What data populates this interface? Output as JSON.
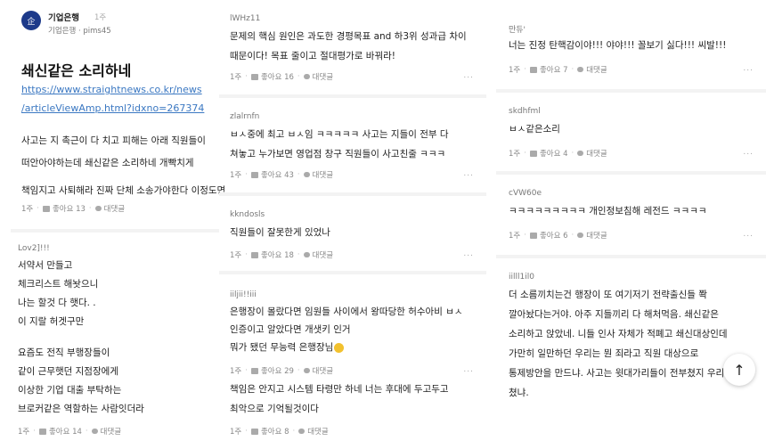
{
  "article": {
    "logo_text": "企",
    "author": "기업은행",
    "time": "1주",
    "sub_company": "기업은행",
    "sub_user": "pims45",
    "title": "쇄신같은 소리하네",
    "link_line1": "https://www.straightnews.co.kr/news",
    "link_line2": "/articleViewAmp.html?idxno=267374",
    "body_line1": "사고는 지 촉근이 다 치고 피해는 아래 직원들이",
    "body_line2": "떠안아야하는데 쇄신같은 소리하네 개빡치게",
    "body_line3": "책임지고 사퇴해라 진짜 단체 소송가야한다 이정도면",
    "time_meta": "1주",
    "likes": "좋아요 13",
    "reply": "대댓글"
  },
  "comments": [
    {
      "nick": "Lov2]!!!",
      "lines": [
        "서약서 만들고",
        "체크리스트 해놧으니",
        "나는 할것 다 햇다. .",
        "이 지랄 허겟구만",
        "",
        "요즘도 전직 부행장들이",
        "같이 근무햇던 지점장에게",
        "이상한 기업 대출 부탁하는",
        "브로커같은 역할하는 사람잇더라"
      ],
      "time": "1주",
      "likes": "좋아요 14",
      "reply": "대댓글"
    },
    {
      "nick": "lWHz11",
      "lines": [
        "문제의 핵심 원인은 과도한 경평목표 and 하3위 성과급 차이",
        "때문이다! 목표 줄이고 절대평가로 바꿔라!"
      ],
      "time": "1주",
      "likes": "좋아요 16",
      "reply": "대댓글"
    },
    {
      "nick": "zlalrnfn",
      "lines": [
        "ㅂㅅ중에 최고 ㅂㅅ임 ㅋㅋㅋㅋㅋ 사고는 지들이 전부 다",
        "쳐놓고 누가보면 영업점 창구 직원들이 사고친줄 ㅋㅋㅋ"
      ],
      "time": "1주",
      "likes": "좋아요 43",
      "reply": "대댓글"
    },
    {
      "nick": "kkndosls",
      "lines": [
        "직원들이 잘못한게 있었나"
      ],
      "time": "1주",
      "likes": "좋아요 18",
      "reply": "대댓글"
    },
    {
      "nick": "iiljii!!iii",
      "lines": [
        "은행장이 몰랐다면 임원들 사이에서 왕따당한 허수아비 ㅂㅅ",
        "인증이고 알았다면 개샛키 인거",
        "뭐가 됐던 무능력 은행장님"
      ],
      "time": "1주",
      "likes": "좋아요 29",
      "reply": "대댓글"
    },
    {
      "nick": "",
      "lines": [
        "책임은 안지고 시스템 타령만 하네 너는 후대에 두고두고",
        "최악으로 기억될것이다"
      ],
      "time": "1주",
      "likes": "좋아요 8",
      "reply": "대댓글"
    },
    {
      "nick": "만듀'",
      "lines": [
        "너는 진정 탄핵감이야!!! 야야!!! 꼴보기 싫다!!! 씨발!!!"
      ],
      "time": "1주",
      "likes": "좋아요 7",
      "reply": "대댓글"
    },
    {
      "nick": "skdhfml",
      "lines": [
        "ㅂㅅ같은소리"
      ],
      "time": "1주",
      "likes": "좋아요 4",
      "reply": "대댓글"
    },
    {
      "nick": "cVW60e",
      "lines": [
        "ㅋㅋㅋㅋㅋㅋㅋㅋㅋ 개인정보침해 레전드 ㅋㅋㅋㅋ"
      ],
      "time": "1주",
      "likes": "좋아요 6",
      "reply": "대댓글"
    },
    {
      "nick": "iilll1il0",
      "lines": [
        "더 소름끼치는건  행장이 또 여기저기 전략출신들 쫙",
        "깔아놨다는거야. 아주 지들끼리 다 해처먹음. 쇄신같은",
        "소리하고 앉았네. 니들 인사 자체가 적폐고 쇄신대상인데",
        "가만히 일만하던 우리는 뭔 죄라고 직원 대상으로",
        "통제방안을 만드냐. 사고는 윗대가리들이 전부쳤지 우리가",
        "쳤냐."
      ],
      "time": "",
      "likes": "",
      "reply": ""
    }
  ],
  "ui": {
    "more": "...",
    "dot": "·",
    "scroll_top": "↑"
  }
}
